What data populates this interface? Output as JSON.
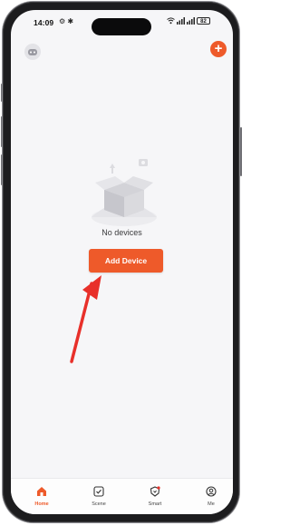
{
  "status_bar": {
    "time": "14:09",
    "left_icons": "⚙ ✱",
    "battery": "82"
  },
  "header": {
    "left_icon": "robot-face-icon",
    "right_icon": "plus-icon"
  },
  "empty_state": {
    "message": "No devices",
    "illustration": "empty-box-icon"
  },
  "primary_action": {
    "label": "Add Device"
  },
  "annotation": {
    "type": "red-arrow",
    "color": "#e8302a"
  },
  "tabs": [
    {
      "label": "Home",
      "icon": "home-icon",
      "active": true
    },
    {
      "label": "Scene",
      "icon": "checkbox-icon",
      "active": false
    },
    {
      "label": "Smart",
      "icon": "smart-shield-icon",
      "active": false
    },
    {
      "label": "Me",
      "icon": "user-circle-icon",
      "active": false
    }
  ],
  "colors": {
    "accent": "#ee5a2a",
    "background": "#f6f6f8",
    "arrow": "#e8302a"
  }
}
